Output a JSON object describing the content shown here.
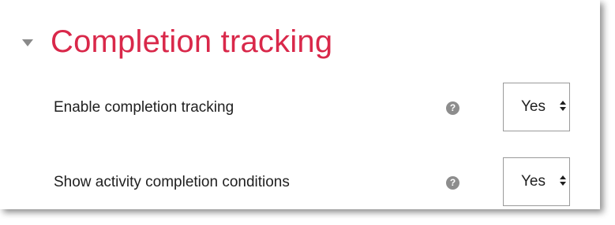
{
  "section": {
    "title": "Completion tracking",
    "toggle_icon": "caret-down-icon",
    "title_color": "#d9284a"
  },
  "settings": [
    {
      "label": "Enable completion tracking",
      "help_icon": "question-circle-icon",
      "help_glyph": "?",
      "value": "Yes"
    },
    {
      "label": "Show activity completion conditions",
      "help_icon": "question-circle-icon",
      "help_glyph": "?",
      "value": "Yes"
    }
  ]
}
